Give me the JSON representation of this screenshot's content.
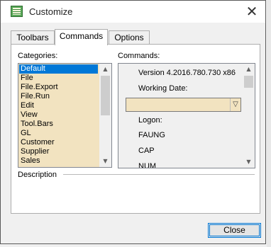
{
  "window": {
    "title": "Customize",
    "close_glyph": "✕"
  },
  "tabs": [
    {
      "label": "Toolbars",
      "active": false
    },
    {
      "label": "Commands",
      "active": true
    },
    {
      "label": "Options",
      "active": false
    }
  ],
  "categories": {
    "label": "Categories:",
    "selected": "Default",
    "items": [
      "Default",
      "File",
      "File.Export",
      "File.Run",
      "Edit",
      "View",
      "Tool.Bars",
      "GL",
      "Customer",
      "Supplier",
      "Sales"
    ]
  },
  "commands": {
    "label": "Commands:",
    "version": "Version 4.2016.780.730 x86",
    "working_date_label": "Working Date:",
    "working_date_value": "",
    "logon_label": "Logon:",
    "items": [
      "FAUNG",
      "CAP",
      "NUM"
    ]
  },
  "description": {
    "label": "Description"
  },
  "buttons": {
    "close": "Close"
  },
  "colors": {
    "list_background": "#f2e3c0",
    "selection": "#0078d7",
    "button_focus_border": "#0078d7"
  }
}
